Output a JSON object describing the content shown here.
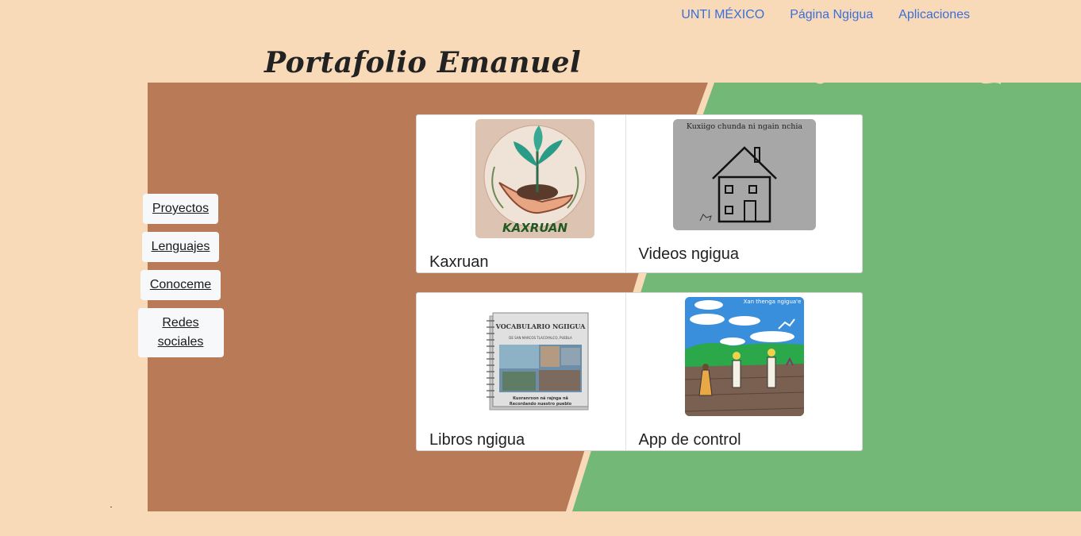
{
  "nav": {
    "links": [
      "UNTI MÉXICO",
      "Página Ngigua",
      "Aplicaciones"
    ]
  },
  "header": {
    "title": "Portafolio Emanuel"
  },
  "sidebar": {
    "items": [
      "Proyectos",
      "Lenguajes",
      "Conoceme",
      "Redes sociales"
    ]
  },
  "projects": [
    {
      "label": "Kaxruan",
      "image_text": "KAXRUAN"
    },
    {
      "label": "Videos ngigua",
      "image_text": "Kuxiigo chunda ni ngain nchia"
    },
    {
      "label": "Libros ngigua",
      "image_text": [
        "VOCABULARIO NGIIGUA",
        "DE SAN MARCOS TLACOYALCO, PUEBLA",
        "Kuxranrxon ná rajnga nâ",
        "Recordando nuestro pueblo"
      ]
    },
    {
      "label": "App de control",
      "image_text": "Xan thenga ngigua'e"
    }
  ],
  "colors": {
    "background": "#f8dab9",
    "brown_panel": "#b87a57",
    "green_panel": "#74b878",
    "link": "#3b6fd8"
  }
}
